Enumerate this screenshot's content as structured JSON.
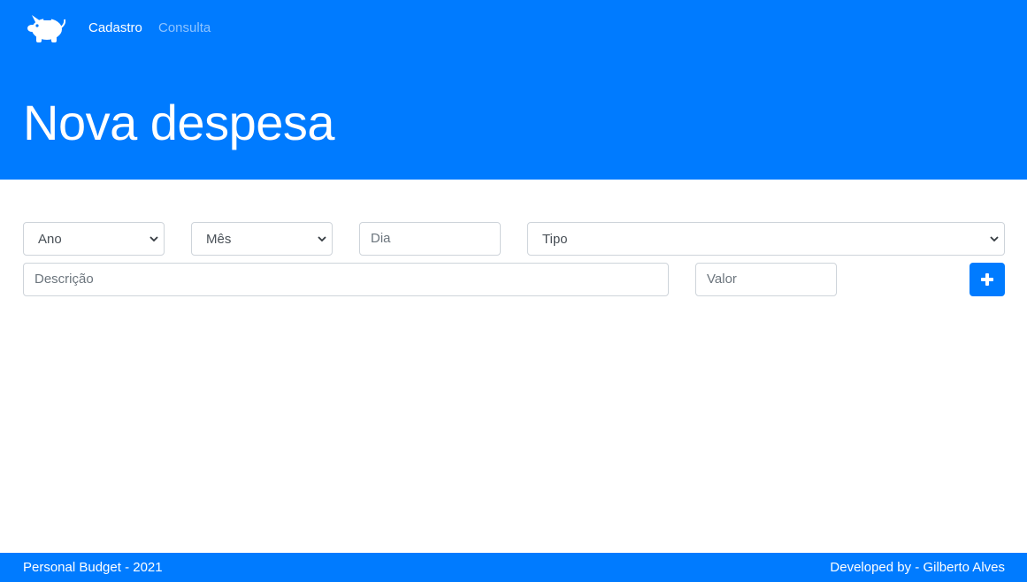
{
  "nav": {
    "logo_icon": "piggy-bank-icon",
    "items": [
      {
        "label": "Cadastro",
        "active": true
      },
      {
        "label": "Consulta",
        "active": false
      }
    ]
  },
  "header": {
    "title": "Nova despesa",
    "background_color": "#007bff"
  },
  "form": {
    "ano": {
      "selected": "Ano"
    },
    "mes": {
      "selected": "Mês"
    },
    "dia": {
      "placeholder": "Dia"
    },
    "tipo": {
      "selected": "Tipo"
    },
    "descricao": {
      "placeholder": "Descrição"
    },
    "valor": {
      "placeholder": "Valor"
    },
    "add_button": {
      "icon": "plus-icon"
    }
  },
  "footer": {
    "left": "Personal Budget - 2021",
    "right": "Developed by - Gilberto Alves"
  }
}
